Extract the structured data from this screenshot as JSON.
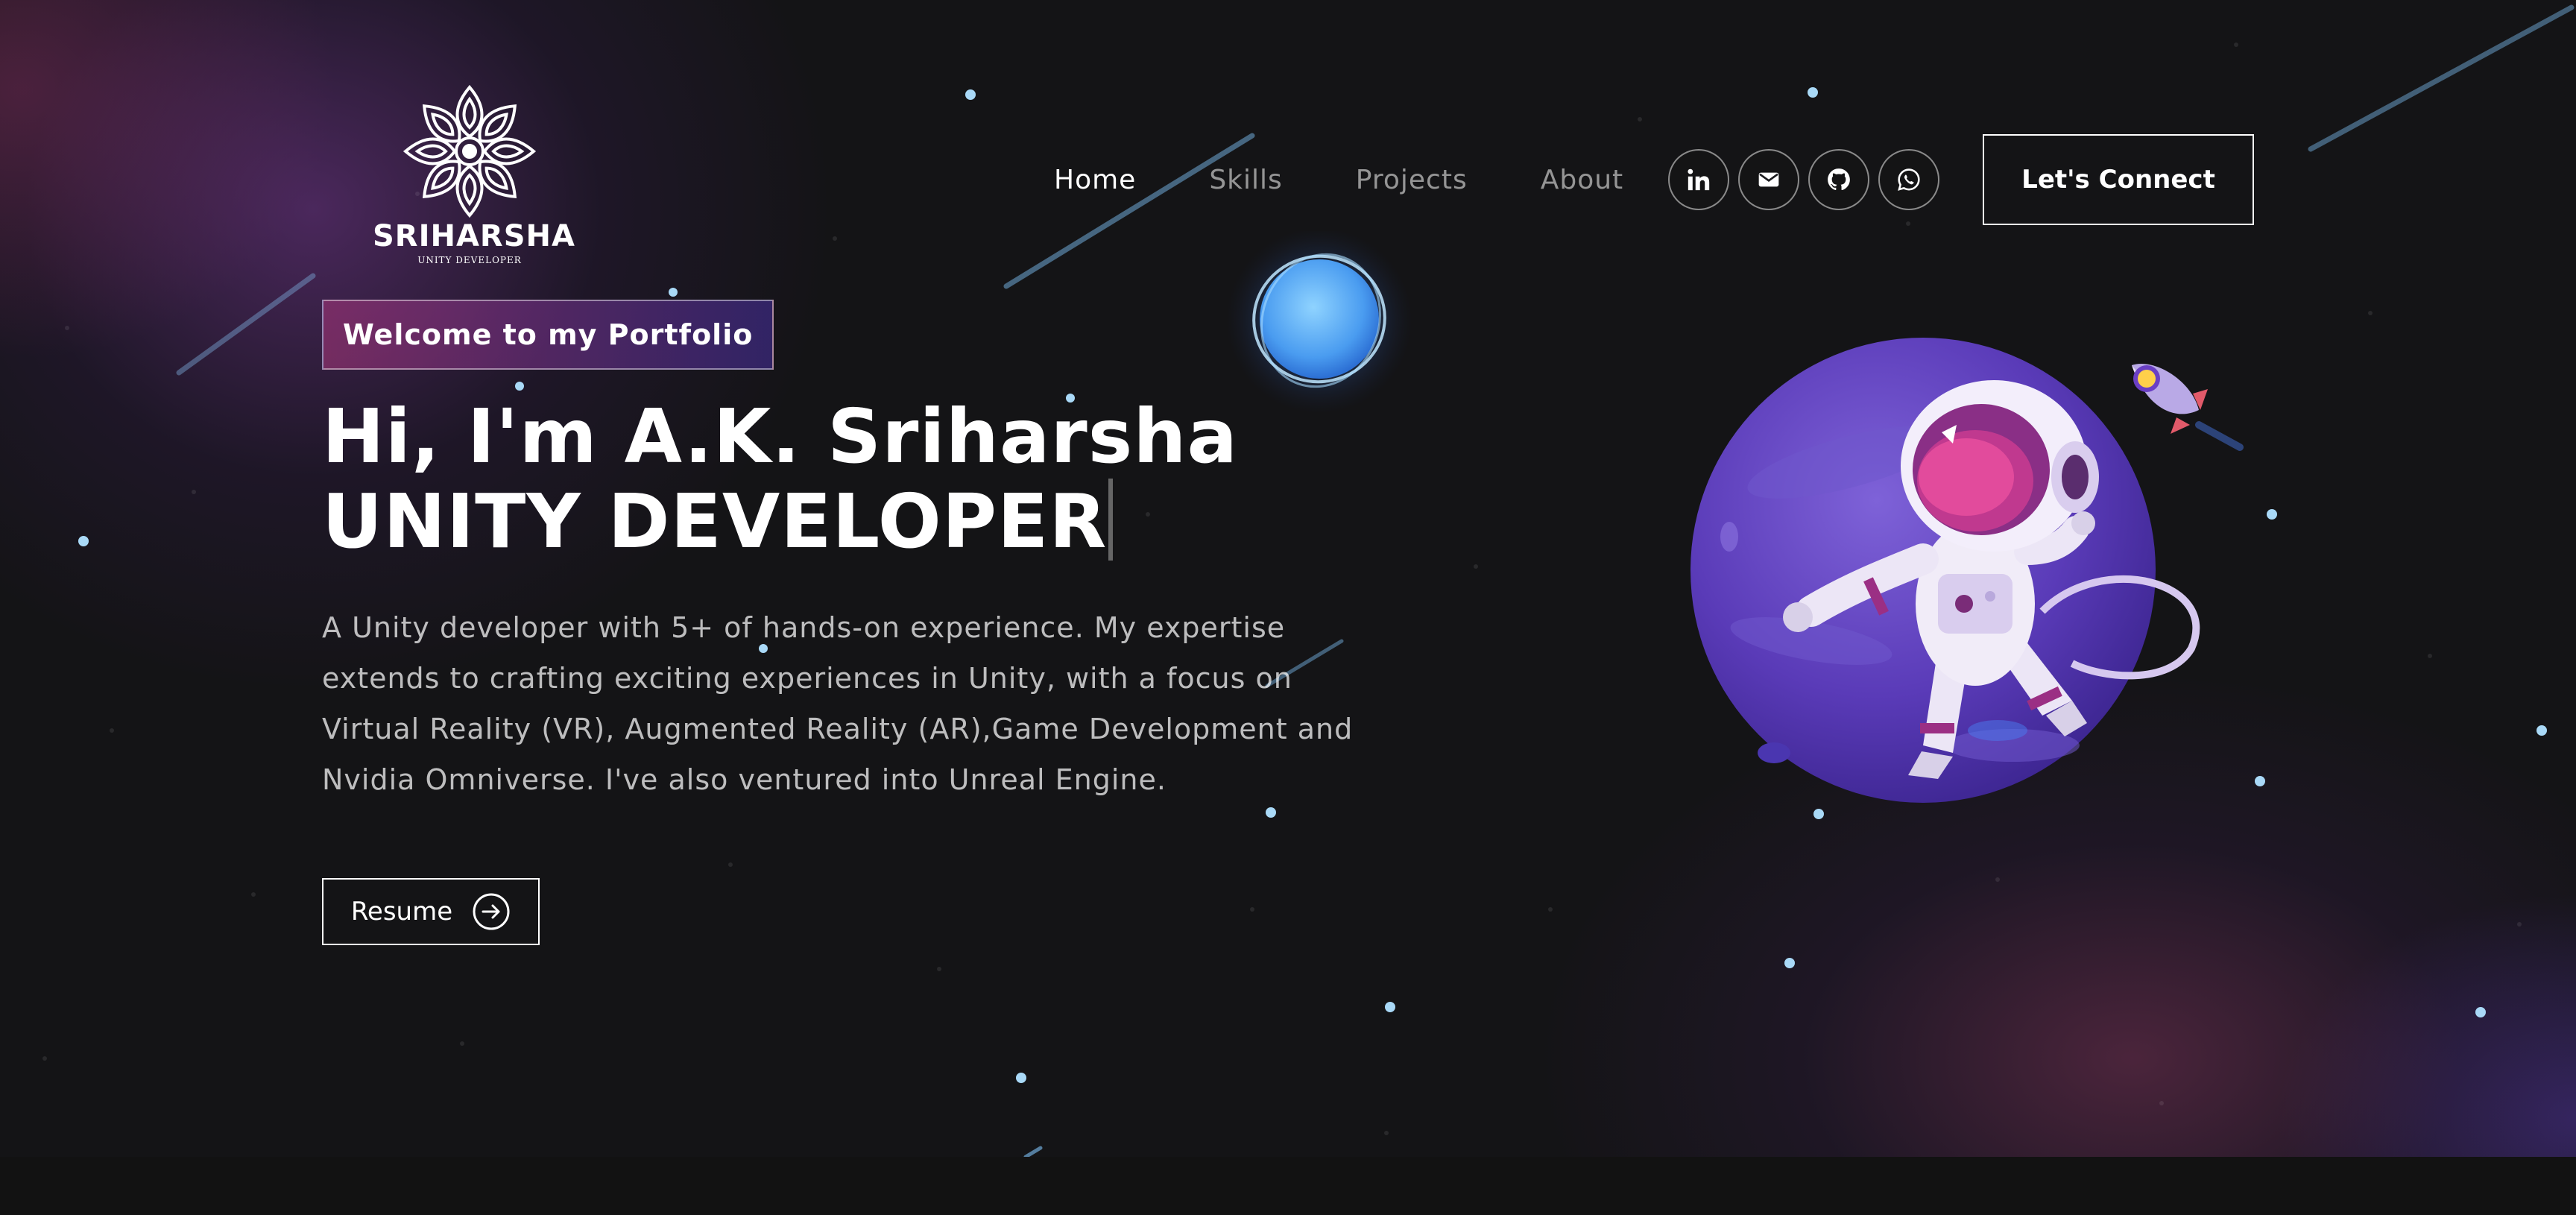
{
  "brand": {
    "name": "SRIHARSHA",
    "subtitle": "UNITY DEVELOPER"
  },
  "nav": {
    "items": [
      {
        "label": "Home",
        "active": true
      },
      {
        "label": "Skills",
        "active": false
      },
      {
        "label": "Projects",
        "active": false
      },
      {
        "label": "About",
        "active": false
      }
    ]
  },
  "socials": [
    {
      "icon": "linkedin-icon"
    },
    {
      "icon": "email-icon"
    },
    {
      "icon": "github-icon"
    },
    {
      "icon": "whatsapp-icon"
    }
  ],
  "connect_button": "Let's Connect",
  "hero": {
    "tagline": "Welcome to my Portfolio",
    "headline_line1": "Hi, I'm A.K. Sriharsha",
    "headline_line2": "UNITY DEVELOPER",
    "description": "A Unity developer with 5+ of hands-on experience. My expertise extends to crafting exciting experiences in Unity, with a focus on Virtual Reality (VR), Augmented Reality (AR),Game Development and Nvidia Omniverse. I've also ventured into Unreal Engine.",
    "resume_button": "Resume"
  },
  "colors": {
    "background": "#141416",
    "accent_pink": "#aa367c",
    "accent_purple": "#4830a3",
    "planet": "#6a3fc4",
    "orb": "#5aa8ff"
  }
}
